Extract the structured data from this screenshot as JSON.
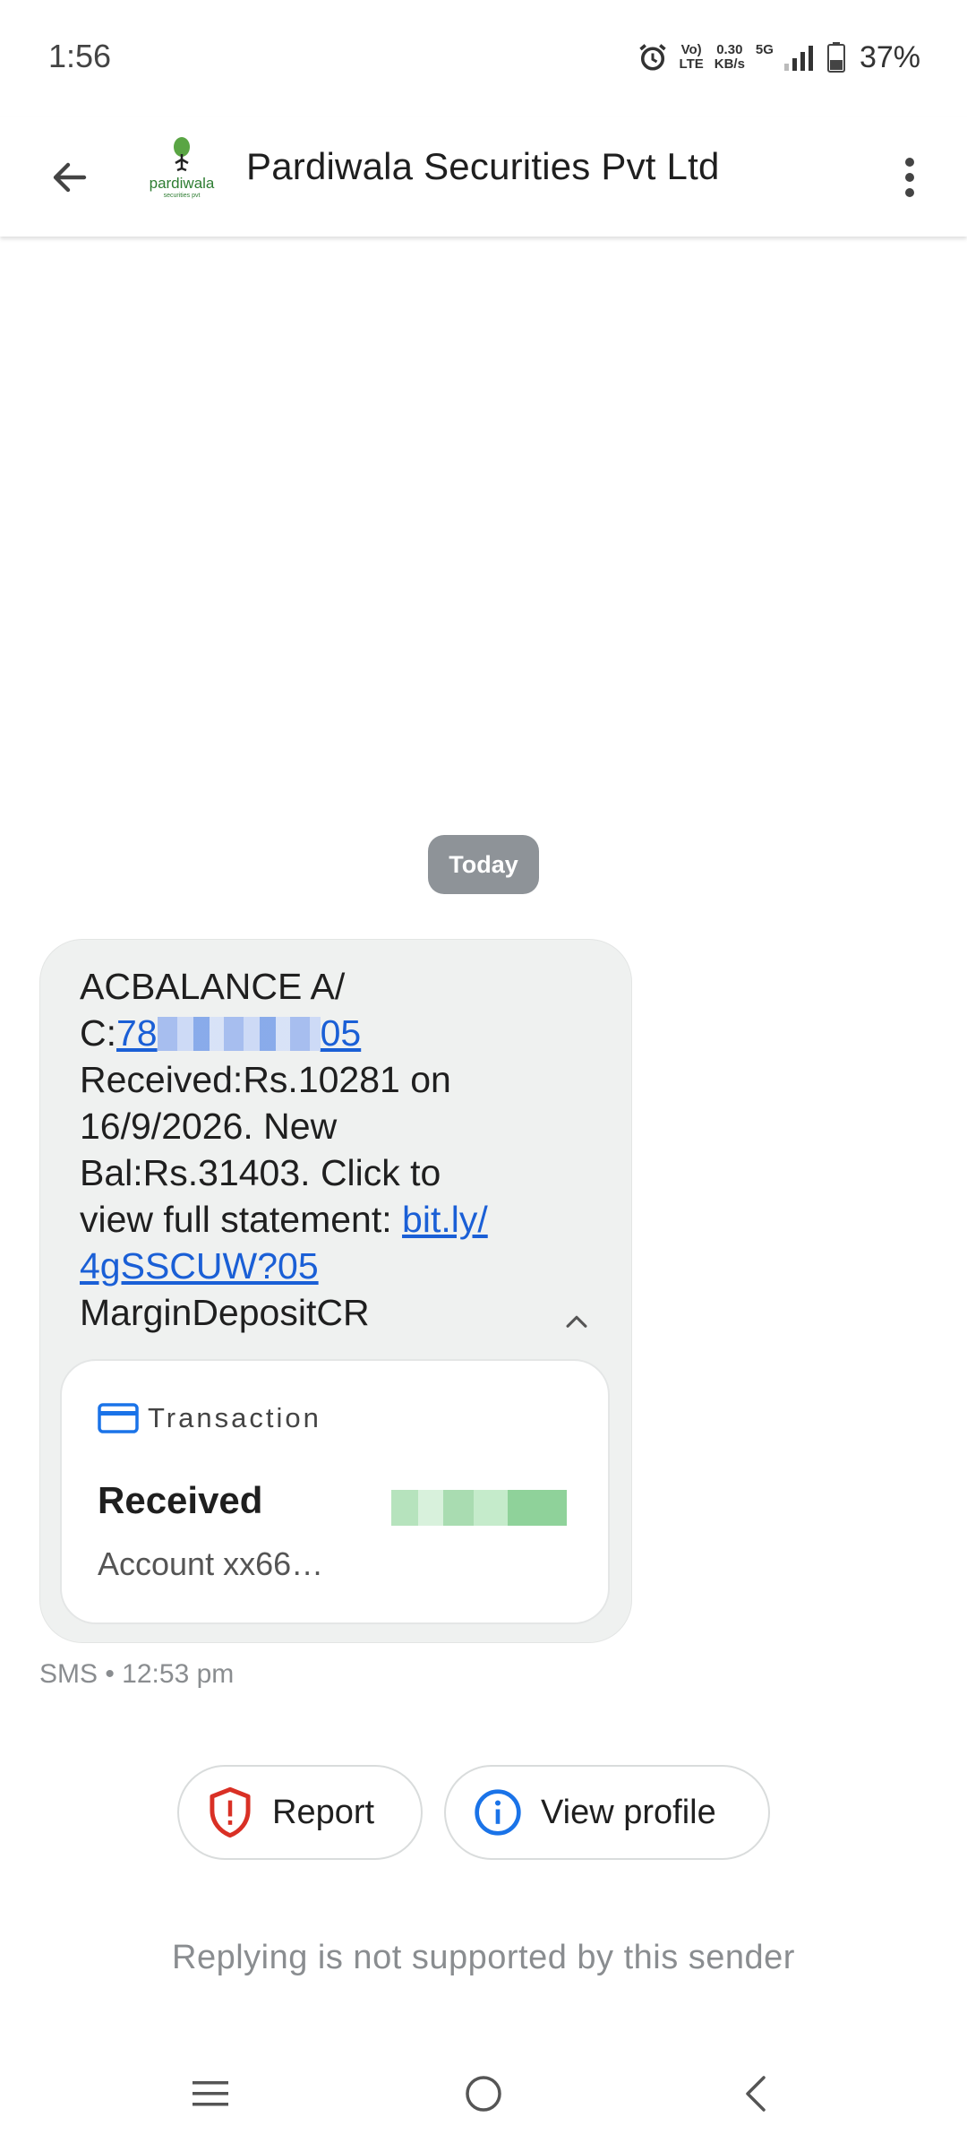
{
  "status_bar": {
    "time": "1:56",
    "volte_top": "Vo)",
    "volte_bottom": "LTE",
    "speed_top": "0.30",
    "speed_bottom": "KB/s",
    "network": "5G",
    "battery": "37%"
  },
  "app_bar": {
    "title": "Pardiwala Securities Pvt Ltd",
    "avatar_logo_text": "pardiwala",
    "avatar_logo_sub": "securities pvt"
  },
  "conversation": {
    "date_chip": "Today",
    "message": {
      "line1": "ACBALANCE A/",
      "line2_prefix": "C:",
      "account_link_start": "78",
      "account_link_end": "05",
      "line3": "Received:Rs.10281 on",
      "line4": "16/9/2026. New",
      "line5": "Bal:Rs.31403. Click to",
      "line6_prefix": "view full statement: ",
      "url_part1": "bit.ly/",
      "url_part2": "4gSSCUW?05",
      "line8": "MarginDepositCR"
    },
    "transaction_card": {
      "label": "Transaction",
      "status": "Received",
      "account": "Account xx66…"
    },
    "meta": "SMS • 12:53 pm"
  },
  "actions": {
    "report_label": "Report",
    "view_profile_label": "View profile"
  },
  "reply_note": "Replying is not supported by this sender",
  "colors": {
    "link": "#1a5fd6",
    "report_icon": "#d93025",
    "info_icon": "#1a73e8",
    "card_icon": "#1a73e8",
    "bubble_bg": "#eff1f0",
    "chip_bg": "#8e9398"
  }
}
